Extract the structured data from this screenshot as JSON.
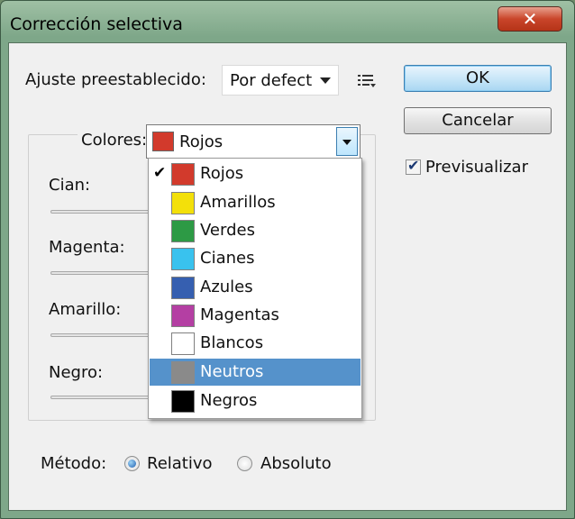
{
  "window": {
    "title": "Corrección selectiva",
    "close_glyph": "✕"
  },
  "preset": {
    "label": "Ajuste preestablecido:",
    "value": "Por defect"
  },
  "buttons": {
    "ok": "OK",
    "cancel": "Cancelar"
  },
  "preview": {
    "label": "Previsualizar",
    "checked": true
  },
  "colors": {
    "label": "Colores:",
    "selected": "Rojos",
    "selected_color": "#d23a2c",
    "options": [
      {
        "label": "Rojos",
        "color": "#d23a2c",
        "checked": true
      },
      {
        "label": "Amarillos",
        "color": "#f3e00a"
      },
      {
        "label": "Verdes",
        "color": "#2d9a45"
      },
      {
        "label": "Cianes",
        "color": "#39c2ee"
      },
      {
        "label": "Azules",
        "color": "#365fb0"
      },
      {
        "label": "Magentas",
        "color": "#b43fa3"
      },
      {
        "label": "Blancos",
        "color": "#ffffff"
      },
      {
        "label": "Neutros",
        "color": "#8a8a8a",
        "highlighted": true
      },
      {
        "label": "Negros",
        "color": "#000000"
      }
    ]
  },
  "sliders": {
    "cian": "Cian:",
    "magenta": "Magenta:",
    "amarillo": "Amarillo:",
    "negro": "Negro:"
  },
  "method": {
    "label": "Método:",
    "relative": "Relativo",
    "absolute": "Absoluto",
    "selected": "Relativo"
  },
  "icons": {
    "options_menu": "list-menu-icon",
    "checkmark": "checkmark-icon",
    "dropdown": "chevron-down-icon",
    "close": "close-icon"
  },
  "glyphs": {
    "check": "✔"
  }
}
